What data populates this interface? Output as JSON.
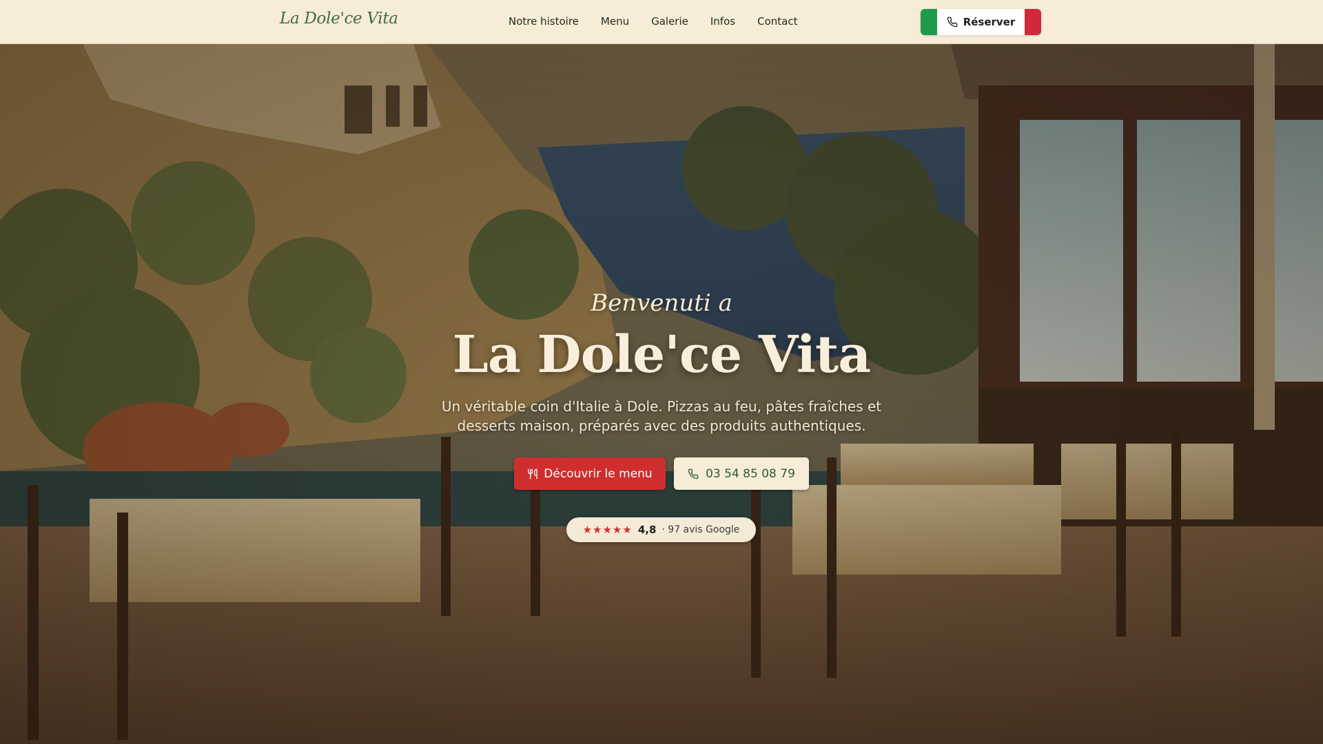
{
  "header": {
    "logo": "La Dole'ce Vita",
    "nav": [
      "Notre histoire",
      "Menu",
      "Galerie",
      "Infos",
      "Contact"
    ],
    "reserve_label": "Réserver"
  },
  "hero": {
    "welcome": "Benvenuti a",
    "title": "La Dole'ce Vita",
    "subtitle": "Un véritable coin d'Italie à Dole. Pizzas au feu, pâtes fraîches et desserts maison, préparés avec des produits authentiques.",
    "menu_button": "Découvrir le menu",
    "phone_button": "03 54 85 08 79",
    "rating": {
      "stars": "★★★★★",
      "score": "4,8",
      "reviews": "· 97 avis Google",
      "value": 4.8
    }
  },
  "icons": {
    "phone": "phone-icon",
    "utensils": "utensils-icon",
    "star": "star-icon"
  },
  "colors": {
    "header_bg": "#f6ecd7",
    "accent_green": "#3f6b3f",
    "accent_red": "#cf2e2e",
    "flag_green": "#1d9a4a",
    "flag_red": "#d2293a"
  }
}
